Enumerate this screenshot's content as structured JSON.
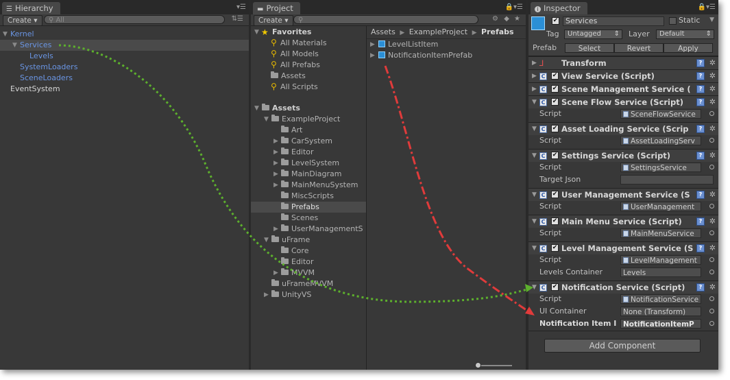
{
  "colors": {
    "arrow_green": "#5db02d",
    "arrow_red": "#e03b3b",
    "selection": "#4a4a4a",
    "link_blue": "#6a95e3"
  },
  "hierarchy": {
    "tab_title": "Hierarchy",
    "create_label": "Create ▾",
    "search_placeholder": "All",
    "items": {
      "kernel": "Kernel",
      "services": "Services",
      "levels": "Levels",
      "system_loaders": "SystemLoaders",
      "scene_loaders": "SceneLoaders",
      "event_system": "EventSystem"
    }
  },
  "project": {
    "tab_title": "Project",
    "create_label": "Create ▾",
    "favorites": {
      "header": "Favorites",
      "items": [
        "All Materials",
        "All Models",
        "All Prefabs",
        "Assets",
        "All Scripts"
      ]
    },
    "assets": {
      "header": "Assets",
      "example_project": "ExampleProject",
      "example_children": [
        "Art",
        "CarSystem",
        "Editor",
        "LevelSystem",
        "MainDiagram",
        "MainMenuSystem",
        "MiscScripts",
        "Prefabs",
        "Scenes",
        "UserManagementS"
      ],
      "uframe": "uFrame",
      "uframe_children": [
        "Core",
        "Editor",
        "MVVM"
      ],
      "uframe_mvvm": "uFrameMVVM",
      "unity_vs": "UnityVS"
    },
    "breadcrumb": [
      "Assets",
      "ExampleProject",
      "Prefabs"
    ],
    "files": [
      "LevelListItem",
      "NotificationItemPrefab"
    ]
  },
  "inspector": {
    "tab_title": "Inspector",
    "object_name": "Services",
    "static_label": "Static",
    "tag_label": "Tag",
    "tag_value": "Untagged",
    "layer_label": "Layer",
    "layer_value": "Default",
    "prefab_label": "Prefab",
    "prefab_buttons": {
      "select": "Select",
      "revert": "Revert",
      "apply": "Apply"
    },
    "components": {
      "transform": "Transform",
      "view_service": "View Service (Script)",
      "scene_management": "Scene Management Service (",
      "scene_flow": "Scene Flow Service (Script)",
      "asset_loading": "Asset Loading Service (Scrip",
      "settings": "Settings Service (Script)",
      "user_management": "User Management Service (S",
      "main_menu": "Main Menu Service (Script)",
      "level_management": "Level Management Service (S",
      "notification": "Notification Service (Script)"
    },
    "props": {
      "script_label": "Script",
      "scene_flow_script": "SceneFlowService",
      "asset_loading_script": "AssetLoadingServ",
      "settings_script": "SettingsService",
      "target_json_label": "Target Json",
      "target_json_value": "",
      "user_management_script": "UserManagement",
      "main_menu_script": "MainMenuService",
      "level_management_script": "LevelManagement",
      "levels_container_label": "Levels Container",
      "levels_container_value": "Levels",
      "notification_script": "NotificationService",
      "ui_container_label": "UI Container",
      "ui_container_value": "None (Transform)",
      "notification_item_label": "Notification Item I",
      "notification_item_value": "NotificationItemP"
    },
    "add_component": "Add Component"
  }
}
